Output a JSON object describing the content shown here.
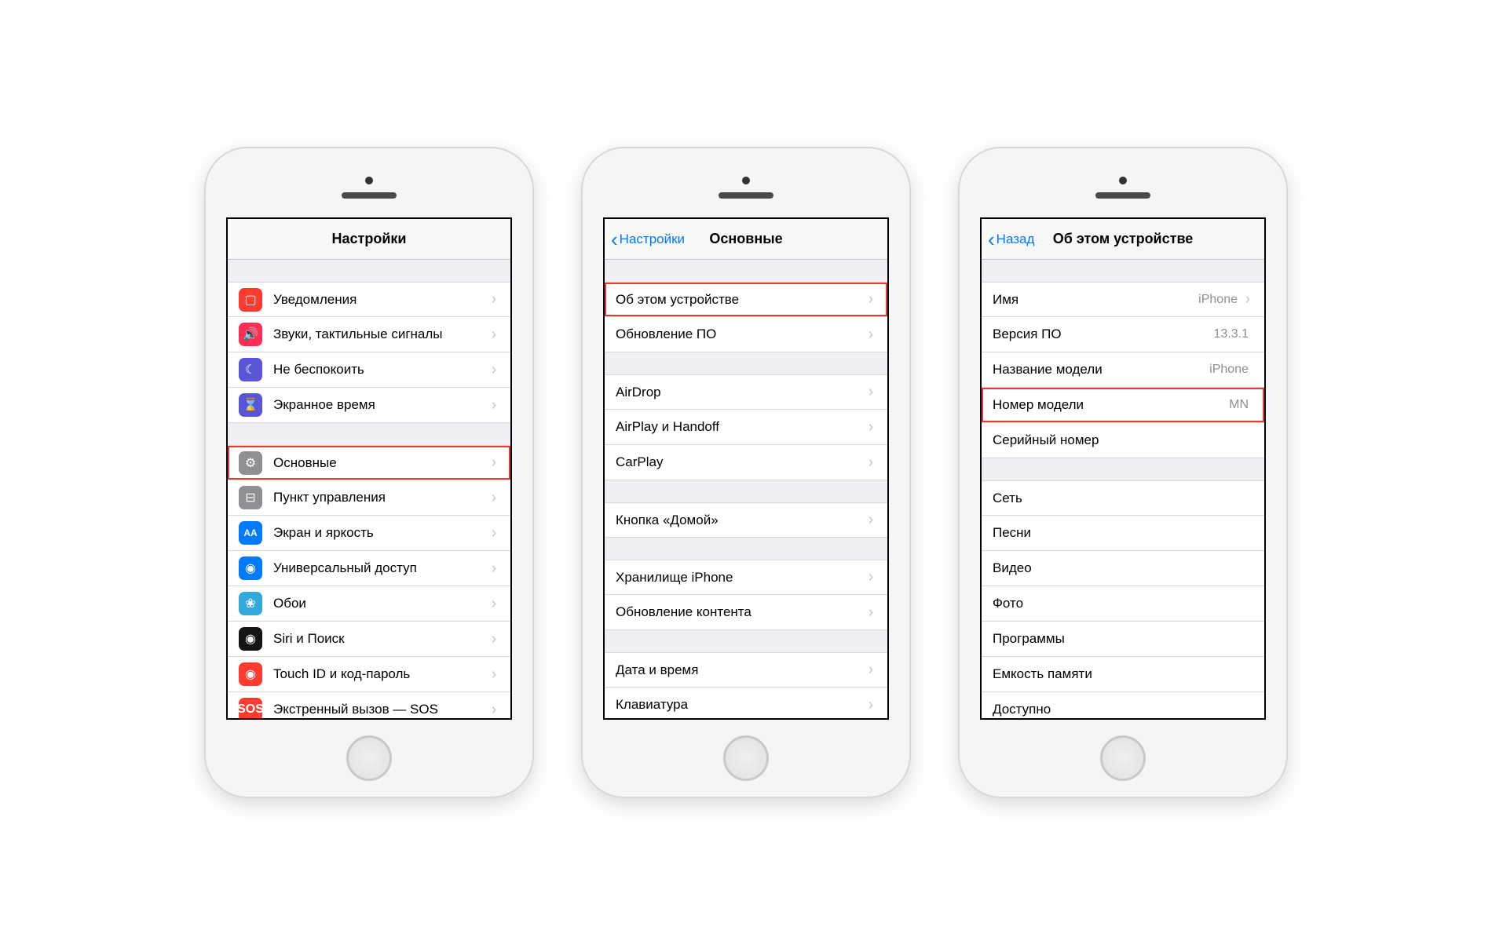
{
  "phone1": {
    "title": "Настройки",
    "rows1": [
      {
        "icon": "notif",
        "label": "Уведомления",
        "glyph": "▢"
      },
      {
        "icon": "sound",
        "label": "Звуки, тактильные сигналы",
        "glyph": "🔊"
      },
      {
        "icon": "dnd",
        "label": "Не беспокоить",
        "glyph": "☾"
      },
      {
        "icon": "screen",
        "label": "Экранное время",
        "glyph": "⌛"
      }
    ],
    "rows2": [
      {
        "icon": "gen",
        "label": "Основные",
        "glyph": "⚙",
        "hl": true
      },
      {
        "icon": "ctrl",
        "label": "Пункт управления",
        "glyph": "⊟"
      },
      {
        "icon": "disp",
        "label": "Экран и яркость",
        "glyph": "AA"
      },
      {
        "icon": "access",
        "label": "Универсальный доступ",
        "glyph": "◉"
      },
      {
        "icon": "wall",
        "label": "Обои",
        "glyph": "❀"
      },
      {
        "icon": "siri",
        "label": "Siri и Поиск",
        "glyph": "◉"
      },
      {
        "icon": "touch",
        "label": "Touch ID и код-пароль",
        "glyph": "◉"
      },
      {
        "icon": "sos",
        "label": "Экстренный вызов — SOS",
        "glyph": "SOS"
      }
    ]
  },
  "phone2": {
    "back": "Настройки",
    "title": "Основные",
    "rows1": [
      {
        "label": "Об этом устройстве",
        "hl": true
      },
      {
        "label": "Обновление ПО"
      }
    ],
    "rows2": [
      {
        "label": "AirDrop"
      },
      {
        "label": "AirPlay и Handoff"
      },
      {
        "label": "CarPlay"
      }
    ],
    "rows3": [
      {
        "label": "Кнопка «Домой»"
      }
    ],
    "rows4": [
      {
        "label": "Хранилище iPhone"
      },
      {
        "label": "Обновление контента"
      }
    ],
    "rows5": [
      {
        "label": "Дата и время"
      },
      {
        "label": "Клавиатура"
      }
    ]
  },
  "phone3": {
    "back": "Назад",
    "title": "Об этом устройстве",
    "rows1": [
      {
        "label": "Имя",
        "value": "iPhone",
        "chev": true
      },
      {
        "label": "Версия ПО",
        "value": "13.3.1"
      },
      {
        "label": "Название модели",
        "value": "iPhone"
      },
      {
        "label": "Номер модели",
        "value": "MN",
        "hl": true
      },
      {
        "label": "Серийный номер"
      }
    ],
    "rows2": [
      {
        "label": "Сеть"
      },
      {
        "label": "Песни"
      },
      {
        "label": "Видео"
      },
      {
        "label": "Фото"
      },
      {
        "label": "Программы"
      },
      {
        "label": "Емкость памяти"
      },
      {
        "label": "Доступно"
      }
    ]
  }
}
